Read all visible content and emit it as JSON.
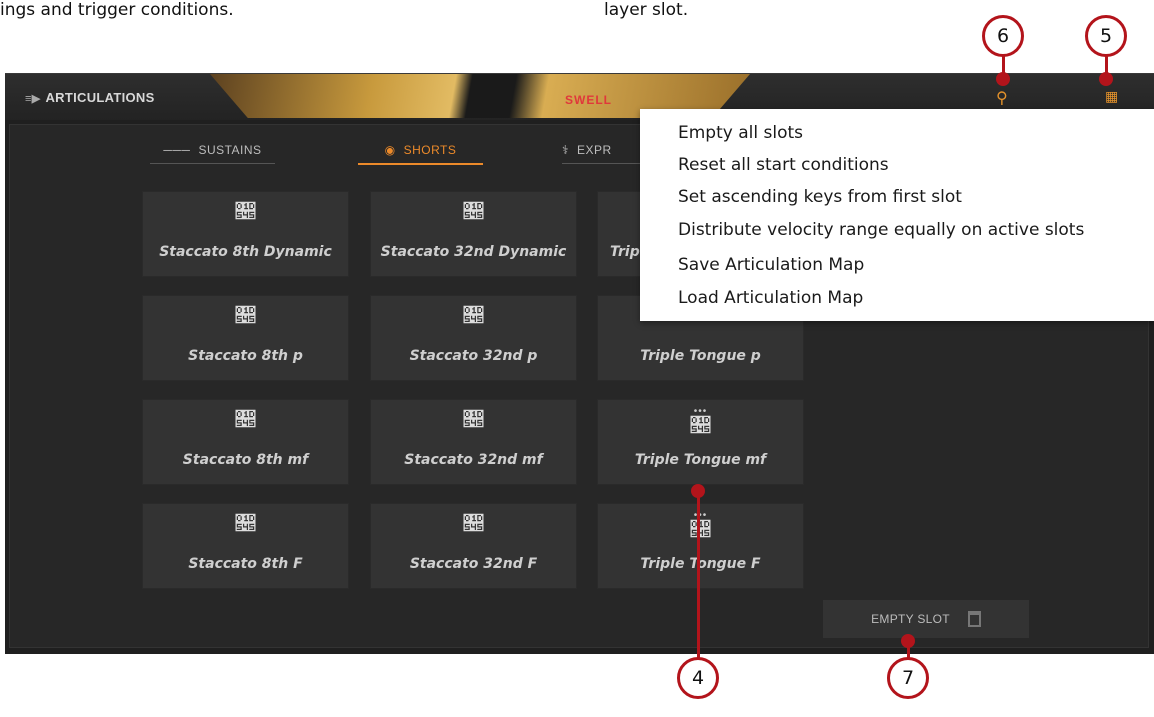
{
  "caption": {
    "left": "ings and trigger conditions.",
    "right": "layer slot."
  },
  "callouts": [
    "6",
    "5",
    "4",
    "7"
  ],
  "header": {
    "title": "ARTICULATIONS",
    "swell": "SWELL",
    "search_icon": "search-icon",
    "menu_icon": "grid-menu-icon"
  },
  "tabs": [
    {
      "label": "SUSTAINS"
    },
    {
      "label": "SHORTS"
    },
    {
      "label": "EXPR"
    }
  ],
  "tiles": [
    [
      "Staccato 8th Dynamic",
      "Staccato 32nd Dynamic",
      "Trip"
    ],
    [
      "Staccato 8th p",
      "Staccato 32nd p",
      "Triple Tongue p"
    ],
    [
      "Staccato 8th mf",
      "Staccato 32nd mf",
      "Triple Tongue mf"
    ],
    [
      "Staccato 8th F",
      "Staccato 32nd F",
      "Triple Tongue F"
    ]
  ],
  "empty_slot": {
    "label": "EMPTY SLOT"
  },
  "menu": {
    "items": [
      "Empty all slots",
      "Reset all start conditions",
      "Set ascending keys from first slot",
      "Distribute velocity range equally on active slots",
      "Save Articulation Map",
      "Load Articulation Map"
    ]
  },
  "colors": {
    "accent": "#ec8a2a",
    "callout": "#b3141b",
    "panel": "#1f1f1f",
    "tile": "#333333"
  }
}
